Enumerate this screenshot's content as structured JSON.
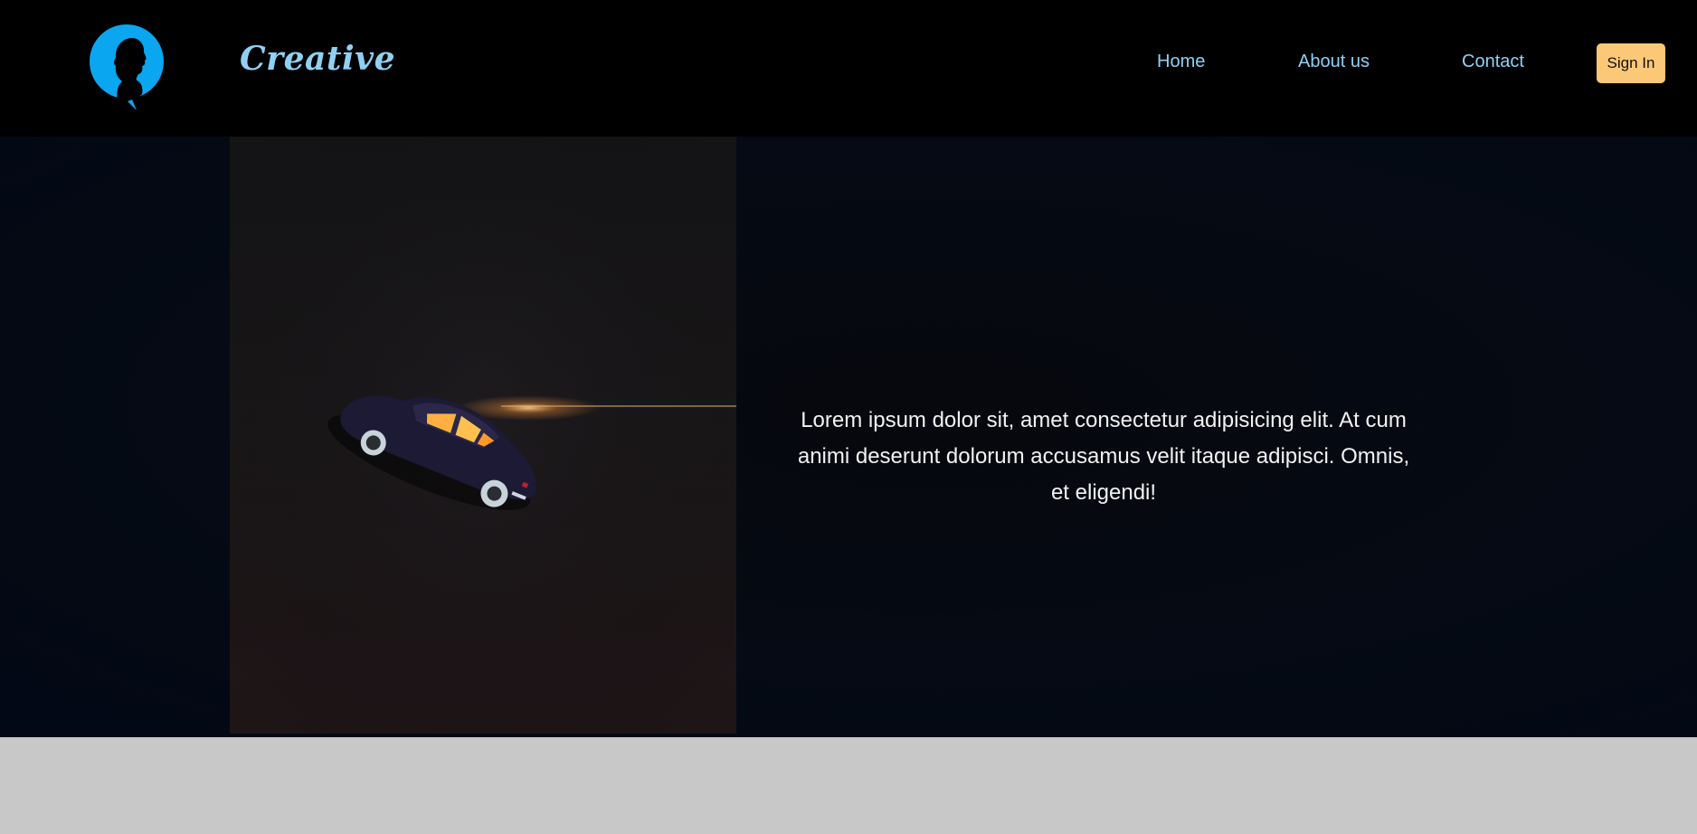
{
  "header": {
    "logo_icon": "person-silhouette-logo",
    "brand": "Creative",
    "nav": [
      {
        "label": "Home"
      },
      {
        "label": "About us"
      },
      {
        "label": "Contact"
      }
    ],
    "signin_label": "Sign In"
  },
  "hero": {
    "image_icon": "vintage-car-photo",
    "text": "Lorem ipsum dolor sit, amet consectetur adipisicing elit. At cum animi deserunt dolorum accusamus velit itaque adipisci. Omnis, et eligendi!"
  },
  "colors": {
    "header_bg": "#000000",
    "accent": "#8fd1f4",
    "logo_blue": "#0aa6f0",
    "signin_bg": "#fbc878",
    "hero_bg": "#040912",
    "footer_bg": "#c8c8c8"
  }
}
